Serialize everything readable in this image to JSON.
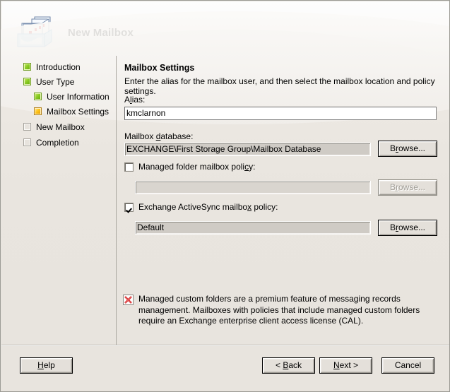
{
  "window": {
    "title": "New Mailbox",
    "icon": "mailbox-tray-icon"
  },
  "sidebar": {
    "items": [
      {
        "label": "Introduction",
        "state": "done",
        "indent": 0,
        "icon": "status-square-green-icon"
      },
      {
        "label": "User Type",
        "state": "done",
        "indent": 0,
        "icon": "status-square-green-icon"
      },
      {
        "label": "User Information",
        "state": "done",
        "indent": 1,
        "icon": "status-square-green-icon"
      },
      {
        "label": "Mailbox Settings",
        "state": "current",
        "indent": 1,
        "icon": "status-square-orange-icon"
      },
      {
        "label": "New Mailbox",
        "state": "todo",
        "indent": 0,
        "icon": "status-square-empty-icon"
      },
      {
        "label": "Completion",
        "state": "todo",
        "indent": 0,
        "icon": "status-square-empty-icon"
      }
    ]
  },
  "main": {
    "pane_title": "Mailbox Settings",
    "pane_description": "Enter the alias for the mailbox user, and then select the mailbox location and policy settings.",
    "alias": {
      "label_pre": "A",
      "label_accel": "l",
      "label_post": "ias:",
      "value": "kmclarnon",
      "placeholder": ""
    },
    "mailbox_database": {
      "label_pre": "Mailbox ",
      "label_accel": "d",
      "label_post": "atabase:",
      "value": "EXCHANGE\\First Storage Group\\Mailbox Database",
      "browse_label_pre": "B",
      "browse_label_accel": "r",
      "browse_label_post": "owse...",
      "enabled": true
    },
    "managed_folder_policy": {
      "label_pre": "Managed folder mailbox poli",
      "label_accel": "c",
      "label_post": "y:",
      "checked": false,
      "value": "",
      "browse_label_pre": "B",
      "browse_label_accel": "r",
      "browse_label_post": "owse...",
      "enabled": false
    },
    "activesync_policy": {
      "label_pre": "Exchange ActiveSync mailbo",
      "label_accel": "x",
      "label_post": " policy:",
      "checked": true,
      "value": "Default",
      "browse_label_pre": "B",
      "browse_label_accel": "r",
      "browse_label_post": "owse...",
      "enabled": true
    },
    "note": {
      "icon": "broken-image-red-x-icon",
      "text": "Managed custom folders are a premium feature of messaging records management. Mailboxes with policies that include managed custom folders require an Exchange enterprise client access license (CAL)."
    }
  },
  "footer": {
    "help": {
      "pre": "",
      "accel": "H",
      "post": "elp"
    },
    "back": {
      "pre": "< ",
      "accel": "B",
      "post": "ack"
    },
    "next": {
      "pre": "",
      "accel": "N",
      "post": "ext >"
    },
    "cancel": {
      "pre": "Cancel",
      "accel": "",
      "post": ""
    }
  },
  "colors": {
    "background": "#e8e4de",
    "header": "#fbfaf9",
    "divider": "#a9a69f",
    "status_done": "#8dcd27",
    "status_current": "#ffc61e",
    "note_icon": "#cc2222"
  }
}
